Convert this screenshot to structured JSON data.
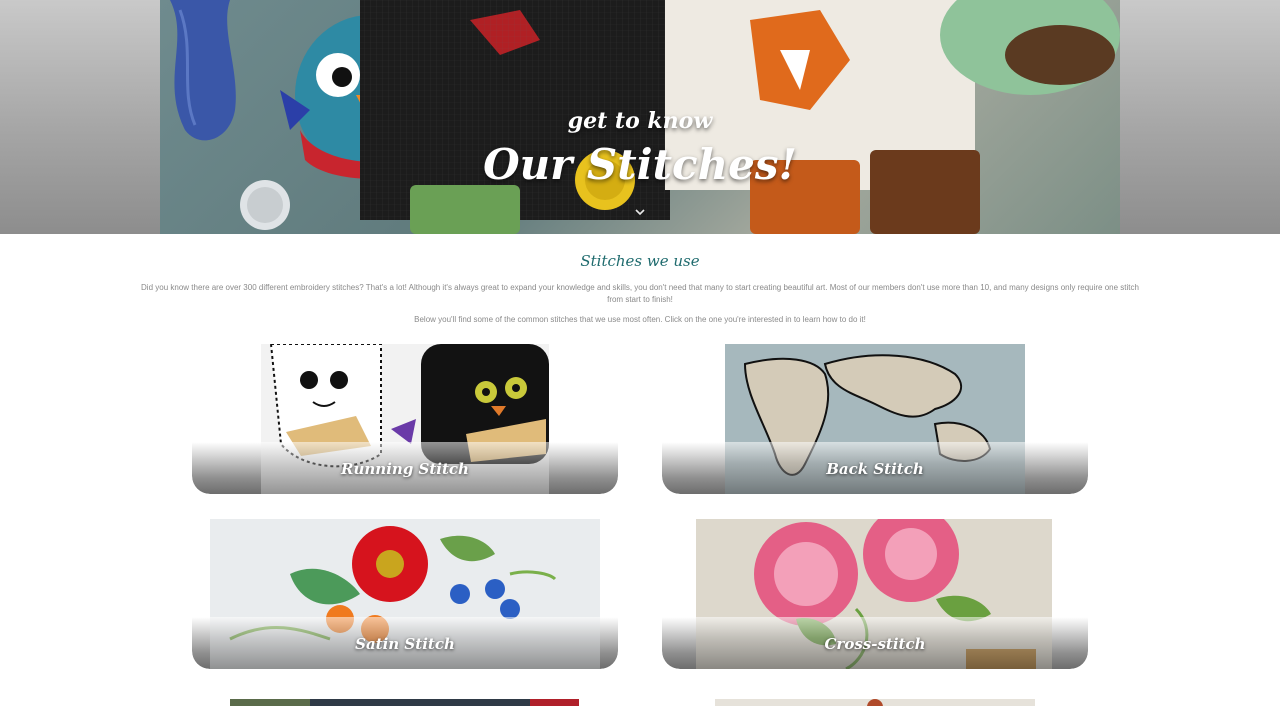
{
  "hero": {
    "subtitle": "get to know",
    "title": "Our Stitches!",
    "scroll_icon": "chevron-down-icon"
  },
  "intro": {
    "heading": "Stitches we use",
    "paragraph1": "Did you know there are over 300 different embroidery stitches? That's a lot! Although it's always great to expand your knowledge and skills, you don't need that many to start creating beautiful art. Most of our members don't use more than 10, and many designs only require one stitch from start to finish!",
    "paragraph2": "Below you'll find some of the common stitches that we use most often. Click on the one you're interested in to learn how to do it!"
  },
  "stitches": [
    {
      "label": "Running Stitch"
    },
    {
      "label": "Back Stitch"
    },
    {
      "label": "Satin Stitch"
    },
    {
      "label": "Cross-stitch"
    }
  ],
  "colors": {
    "heading": "#1f6b6e",
    "body_text": "#8a8a8a",
    "card_band": "#6d6d6d",
    "hero_side": "#a6a6a6"
  }
}
